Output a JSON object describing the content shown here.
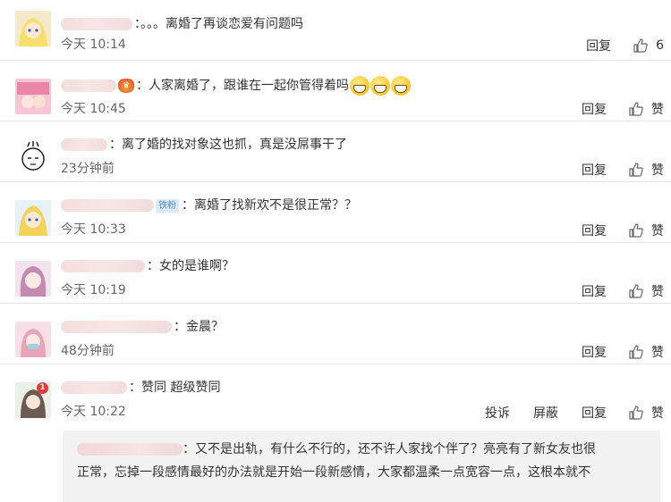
{
  "comments": [
    {
      "text": "：。。。离婚了再谈恋爱有问题吗",
      "time": "今天 10:14",
      "reply": "回复",
      "like": "6"
    },
    {
      "text": "：人家离婚了，跟谁在一起你管得着吗",
      "time": "今天 10:45",
      "reply": "回复",
      "like": "赞"
    },
    {
      "text": "：离了婚的找对象这也抓，真是没屌事干了",
      "time": "23分钟前",
      "reply": "回复",
      "like": "赞"
    },
    {
      "text": "：离婚了找新欢不是很正常？？",
      "fan_tag": "铁粉",
      "time": "今天 10:33",
      "reply": "回复",
      "like": "赞"
    },
    {
      "text": "：女的是谁啊？",
      "time": "今天 10:19",
      "reply": "回复",
      "like": "赞"
    },
    {
      "text": "：金晨？",
      "time": "48分钟前",
      "reply": "回复",
      "like": "赞"
    },
    {
      "text": "：赞同 超级赞同",
      "time": "今天 10:22",
      "report": "投诉",
      "block": "屏蔽",
      "reply": "回复",
      "like": "赞",
      "badge": "1"
    }
  ],
  "nested_reply": {
    "line1": "：又不是出轨，有什么不行的，还不许人家找个伴了？亮亮有了新女友也很",
    "line2": "正常，忘掉一段感情最好的办法就是开始一段新感情，大家都温柔一点宽容一点，这根本就不"
  },
  "colors": {
    "text": "#333333",
    "muted": "#666666",
    "divider": "#e6e6e6",
    "reply_bg": "#f2f2f2"
  },
  "icons": {
    "like": "thumbs-up-icon"
  }
}
